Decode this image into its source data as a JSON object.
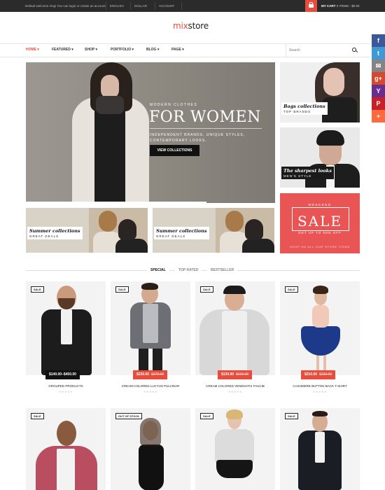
{
  "topbar": {
    "welcome": "Default welcome msg! You can login or create an account",
    "language": "ENGLISH",
    "currency": "DOLLAR",
    "account": "ACCOUNT",
    "cart_label": "MY CART",
    "cart_summary": "0 ITEMS - $0.00"
  },
  "logo": {
    "mix": "mix",
    "store": "store"
  },
  "nav": {
    "items": [
      "HOME",
      "FEATURED",
      "SHOP",
      "PORTFOLIO",
      "BLOG",
      "PAGE"
    ],
    "search_placeholder": "Search"
  },
  "social": [
    "f",
    "t",
    "✉",
    "g+",
    "Y",
    "P",
    "+"
  ],
  "hero": {
    "eyebrow": "MODERN CLOTHES",
    "title": "FOR WOMEN",
    "subtitle": "INDEPENDENT BRANDS, UNIQUE STYLES, CONTEMPORARY LOOKS.",
    "button": "VIEW COLLECTIONS"
  },
  "side_banners": [
    {
      "title": "Bags collections",
      "subtitle": "TOP BRANDS"
    },
    {
      "title": "The sharpest looks",
      "subtitle": "MEN'S STYLE"
    }
  ],
  "summer_banners": [
    {
      "title": "Summer collections",
      "subtitle": "GREAT DEALS"
    },
    {
      "title": "Summer collections",
      "subtitle": "GREAT DEALS"
    }
  ],
  "sale_banner": {
    "eyebrow": "WEEKEND",
    "title": "SALE",
    "offer": "GET UP TO 50% OFF",
    "link": "SHOP ON ALL OUR STORE ITEMS"
  },
  "tabs": [
    "SPECIAL",
    "TOP RATED",
    "BESTSELLER"
  ],
  "products": [
    {
      "badge": "SALE",
      "price": "$140.00–$450.00",
      "old_price": "",
      "name": "GROUPED PRODUCTS"
    },
    {
      "badge": "SALE",
      "price": "$230.00",
      "old_price": "$270.00",
      "name": "CREAM-COLORED LUCTUS PULVINAR"
    },
    {
      "badge": "SALE",
      "price": "$130.00",
      "old_price": "$160.00",
      "name": "CREAM COLORED VENENATIS FAUCIB"
    },
    {
      "badge": "SALE",
      "price": "$210.00",
      "old_price": "$233.00",
      "name": "CASHMERE BUTTON BACK T-SHIRT"
    }
  ],
  "products_row2": [
    {
      "badge": "SALE"
    },
    {
      "badge": "OUT OF STOCK"
    },
    {
      "badge": "SALE"
    },
    {
      "badge": "SALE"
    }
  ],
  "stars": "★★★★★",
  "colors": {
    "accent": "#e74c3c",
    "sale_banner": "#e95454",
    "topbar": "#2b2b2b"
  }
}
